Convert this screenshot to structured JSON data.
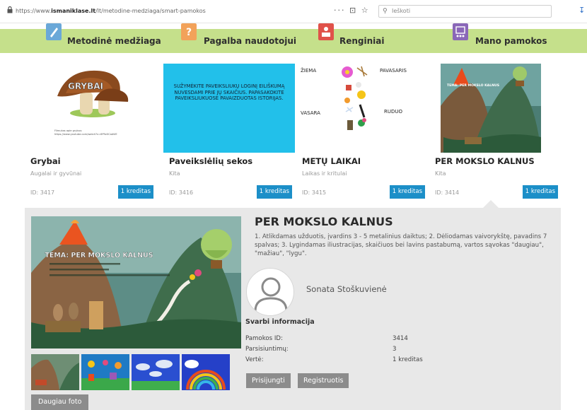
{
  "browser": {
    "url_prefix": "https://www.",
    "url_domain": "ismaniklase.lt",
    "url_path": "/lt/metodine-medziaga/smart-pamokos",
    "controls": "··· ⊡ ☆",
    "search_placeholder": "Ieškoti"
  },
  "nav": {
    "items": [
      {
        "label": "Metodinė medžiaga",
        "color": "#6aa8d8"
      },
      {
        "label": "Pagalba naudotojui",
        "color": "#f2a25a"
      },
      {
        "label": "Renginiai",
        "color": "#e0524a"
      },
      {
        "label": "Mano pamokos",
        "color": "#8a67b8"
      }
    ]
  },
  "cards": [
    {
      "title": "Grybai",
      "subtitle": "Augalai ir gyvūnai",
      "id": "ID: 3417",
      "credit": "1 kreditas",
      "thumb_text": "GRYBAI",
      "thumb_caption": "Filmukas apie grybus:\nhttps://www.youtube.com/watch?v=6P9z0CaAViE"
    },
    {
      "title": "Paveikslėlių sekos",
      "subtitle": "Kita",
      "id": "ID: 3416",
      "credit": "1 kreditas",
      "thumb_text": "SUŽYMĖKITE PAVEIKSLIUKŲ LOGINĮ EILIŠKUMĄ NUVESDAMI PRIE JŲ SKAIČIUS. PAPASAKOKITE PAVEIKSLIUKUOSE PAVAIZDUOTAS ISTORIJAS."
    },
    {
      "title": "METŲ LAIKAI",
      "subtitle": "Laikas ir kritulai",
      "id": "ID: 3415",
      "credit": "1 kreditas",
      "seasons": [
        "ŽIEMA",
        "PAVASARIS",
        "VASARA",
        "RUDUO"
      ]
    },
    {
      "title": "PER MOKSLO KALNUS",
      "subtitle": "Kita",
      "id": "ID: 3414",
      "credit": "1 kreditas",
      "thumb_text": "TEMA: PER MOKSLO KALNUS"
    }
  ],
  "detail": {
    "title": "PER MOKSLO KALNUS",
    "description": "1. Atlikdamas užduotis, įvardins 3 - 5 metalinius daiktus; 2. Dėliodamas vaivorykštę, pavadins 7 spalvas; 3. Lygindamas iliustracijas, skaičiuos bei lavins pastabumą, vartos sąvokas \"daugiau\", \"mažiau\", \"lygu\".",
    "image_title": "TEMA: PER MOKSLO KALNUS",
    "author": "Sonata Stoškuvienė",
    "info_heading": "Svarbi informacija",
    "info": [
      {
        "label": "Pamokos ID:",
        "value": "3414"
      },
      {
        "label": "Parsisiuntimų:",
        "value": "3"
      },
      {
        "label": "Vertė:",
        "value": "1 kreditas"
      }
    ],
    "login_label": "Prisijungti",
    "register_label": "Registruotis",
    "more_photos_label": "Daugiau foto"
  }
}
